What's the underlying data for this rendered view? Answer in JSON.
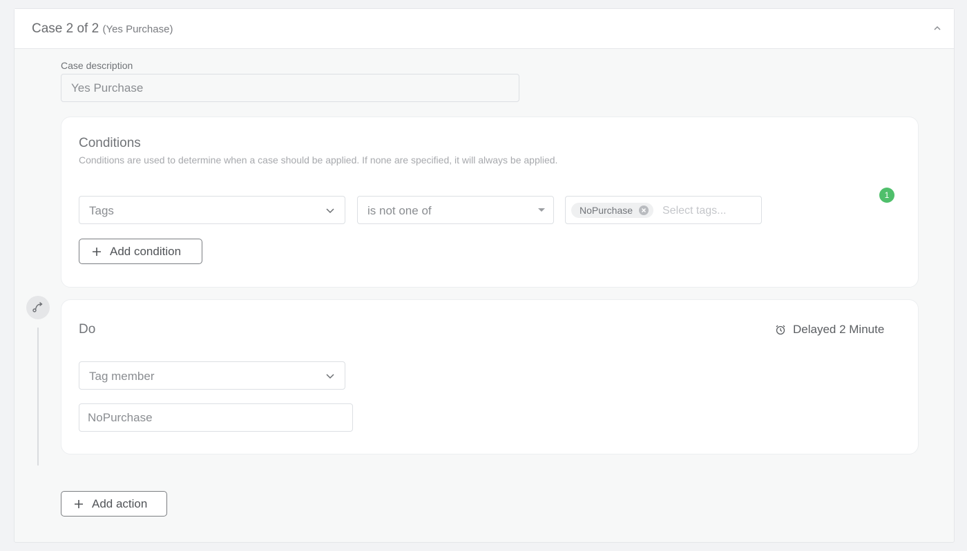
{
  "case": {
    "title": "Case 2 of 2",
    "subtitle": "(Yes Purchase)",
    "description_label": "Case description",
    "description_value": "Yes Purchase"
  },
  "conditions": {
    "title": "Conditions",
    "description": "Conditions are used to determine when a case should be applied. If none are specified, it will always be applied.",
    "field_select": "Tags",
    "operator_select": "is not one of",
    "tags": [
      "NoPurchase"
    ],
    "tags_placeholder": "Select tags...",
    "tag_count": "1",
    "add_condition_label": "Add condition"
  },
  "do": {
    "title": "Do",
    "delay_label": "Delayed 2 Minute",
    "action_select": "Tag member",
    "action_value": "NoPurchase"
  },
  "add_action_label": "Add action",
  "icons": {
    "collapse": "chevron-up-icon",
    "dropdown": "chevron-down-icon",
    "remove_tag": "close-circle-icon",
    "add": "plus-icon",
    "route": "route-icon",
    "delay": "alarm-clock-icon"
  },
  "colors": {
    "badge": "#4fbf6b",
    "background": "#f2f3f5",
    "panel": "#ffffff"
  }
}
